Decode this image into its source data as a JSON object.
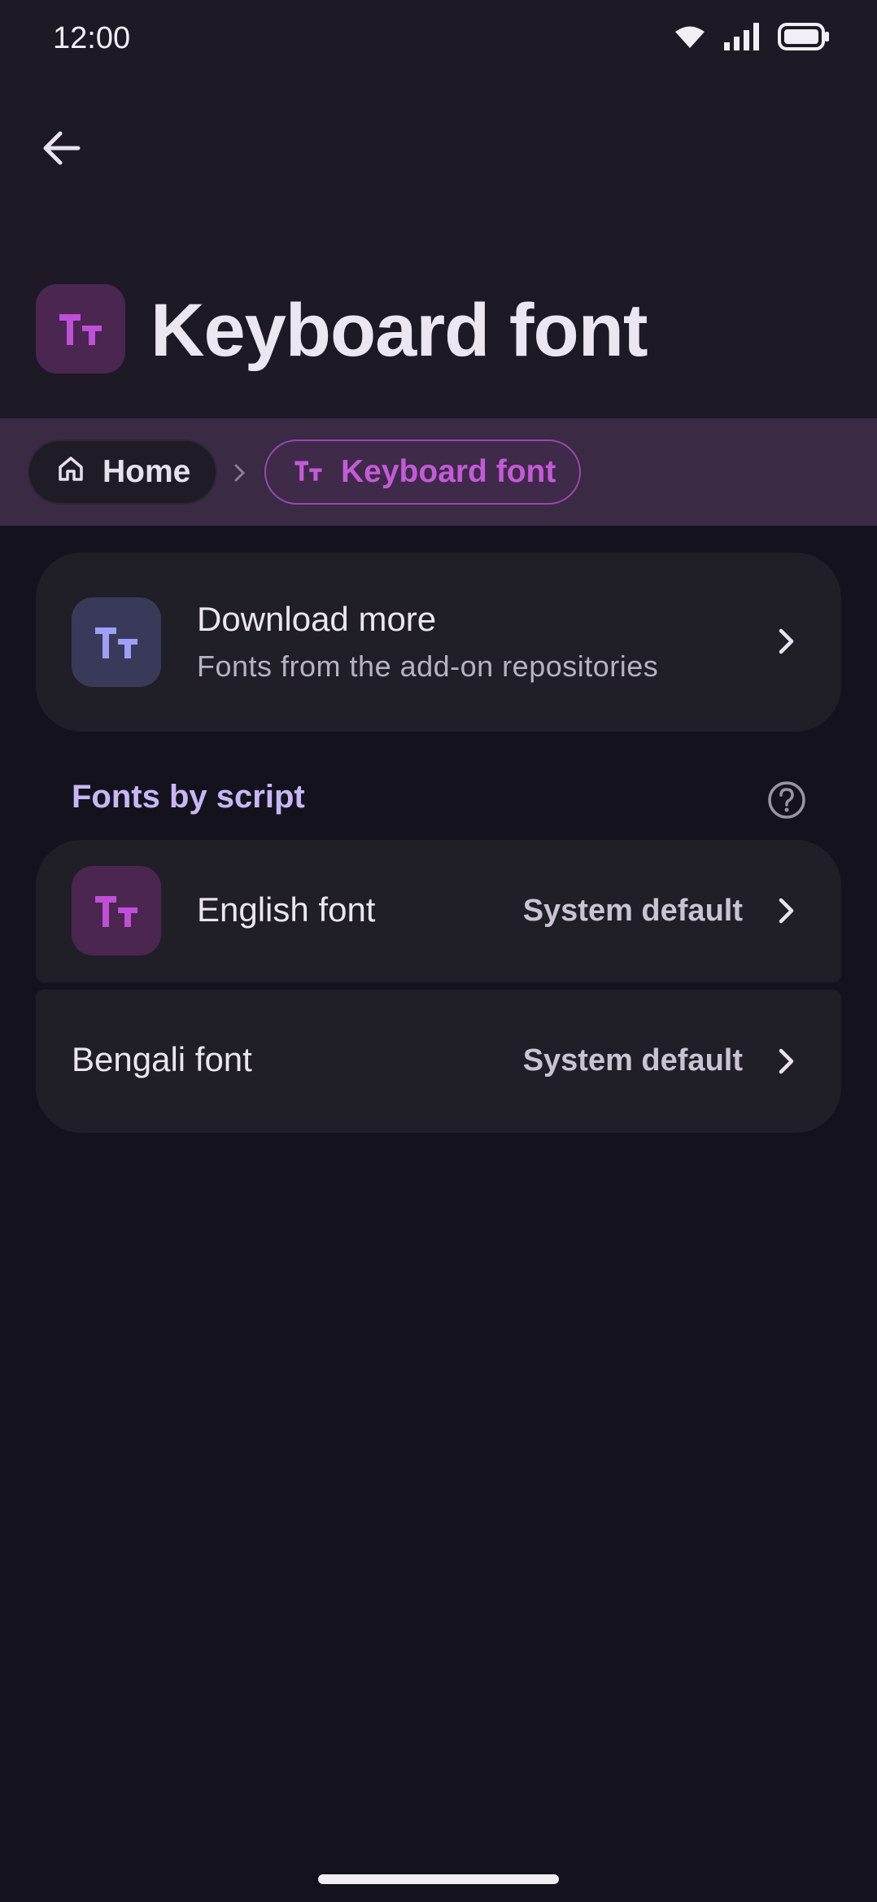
{
  "status_bar": {
    "time": "12:00"
  },
  "header": {
    "title": "Keyboard font",
    "back_icon": "arrow-left-icon",
    "title_icon": "text-size-icon"
  },
  "breadcrumb": {
    "items": [
      {
        "label": "Home",
        "icon": "home-icon"
      },
      {
        "label": "Keyboard font",
        "icon": "text-size-icon"
      }
    ]
  },
  "download_card": {
    "title": "Download more",
    "subtitle": "Fonts from the add-on repositories",
    "icon": "text-size-icon"
  },
  "section": {
    "title": "Fonts by script",
    "help_icon": "help-circle-icon"
  },
  "fonts": [
    {
      "label": "English font",
      "value": "System default"
    },
    {
      "label": "Bengali font",
      "value": "System default"
    }
  ],
  "colors": {
    "accent": "#c45ad8",
    "section_header": "#c8b7f7",
    "background": "#14131d",
    "card": "#201f27"
  }
}
